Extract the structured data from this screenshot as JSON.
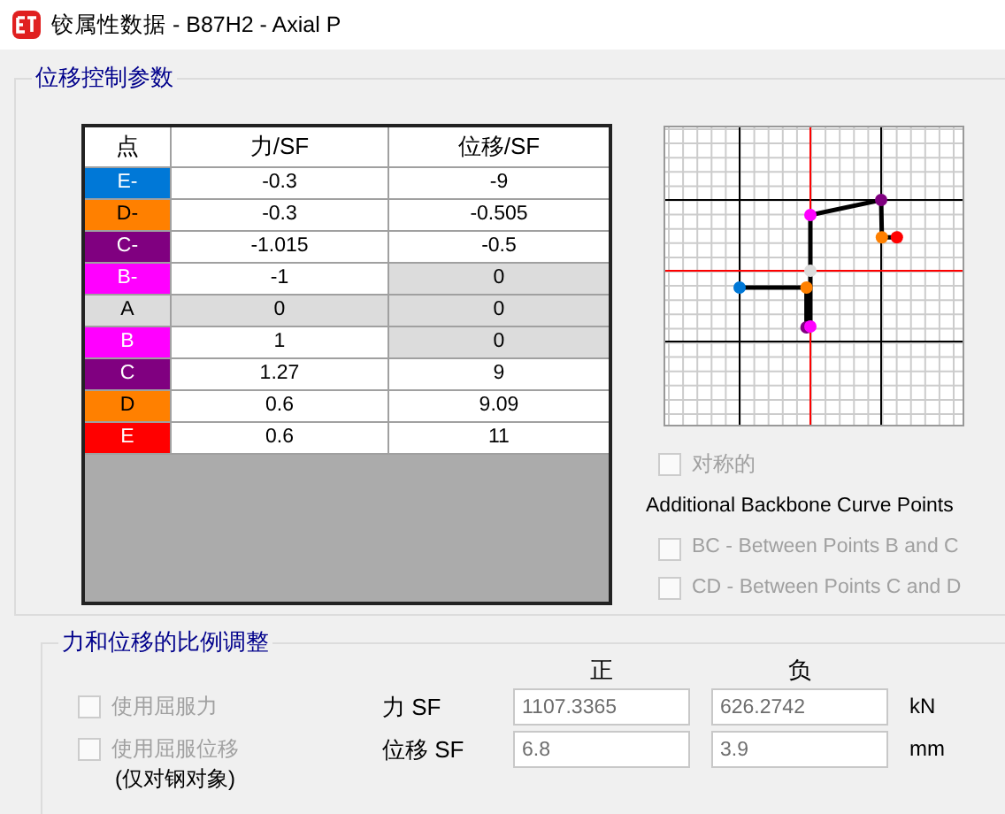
{
  "window": {
    "title": "铰属性数据 -  B87H2 - Axial P"
  },
  "displacement_control": {
    "title": "位移控制参数",
    "table": {
      "columns": [
        "点",
        "力/SF",
        "位移/SF"
      ],
      "rows": [
        {
          "point": "E-",
          "color": "#0078d7",
          "force": "-0.3",
          "force_disabled": false,
          "displacement": "-9",
          "displacement_disabled": false
        },
        {
          "point": "D-",
          "color": "#ff8000",
          "force": "-0.3",
          "force_disabled": false,
          "displacement": "-0.505",
          "displacement_disabled": false
        },
        {
          "point": "C-",
          "color": "#800080",
          "force": "-1.015",
          "force_disabled": false,
          "displacement": "-0.5",
          "displacement_disabled": false
        },
        {
          "point": "B-",
          "color": "#ff00ff",
          "force": "-1",
          "force_disabled": false,
          "displacement": "0",
          "displacement_disabled": true
        },
        {
          "point": "A",
          "color": "#dcdcdc",
          "force": "0",
          "force_disabled": true,
          "displacement": "0",
          "displacement_disabled": true
        },
        {
          "point": "B",
          "color": "#ff00ff",
          "force": "1",
          "force_disabled": false,
          "displacement": "0",
          "displacement_disabled": true
        },
        {
          "point": "C",
          "color": "#800080",
          "force": "1.27",
          "force_disabled": false,
          "displacement": "9",
          "displacement_disabled": false
        },
        {
          "point": "D",
          "color": "#ff8000",
          "force": "0.6",
          "force_disabled": false,
          "displacement": "9.09",
          "displacement_disabled": false
        },
        {
          "point": "E",
          "color": "#ff0000",
          "force": "0.6",
          "force_disabled": false,
          "displacement": "11",
          "displacement_disabled": false
        }
      ]
    },
    "symmetric": {
      "label": "对称的",
      "checked": false,
      "disabled": true
    },
    "additional_heading": "Additional Backbone Curve Points",
    "additional_points": [
      {
        "label": "BC - Between Points B and C",
        "checked": false,
        "disabled": true
      },
      {
        "label": "CD - Between Points C and D",
        "checked": false,
        "disabled": true
      }
    ]
  },
  "scale": {
    "title": "力和位移的比例调整",
    "column_headers": [
      "正",
      "负"
    ],
    "rows": [
      {
        "option": {
          "label": "使用屈服力",
          "checked": false,
          "disabled": true
        },
        "label": "力 SF",
        "positive": "1107.3365",
        "negative": "626.2742",
        "unit": "kN"
      },
      {
        "option": {
          "label": "使用屈服位移",
          "note": "(仅对钢对象)",
          "checked": false,
          "disabled": true
        },
        "label": "位移 SF",
        "positive": "6.8",
        "negative": "3.9",
        "unit": "mm"
      }
    ]
  }
}
